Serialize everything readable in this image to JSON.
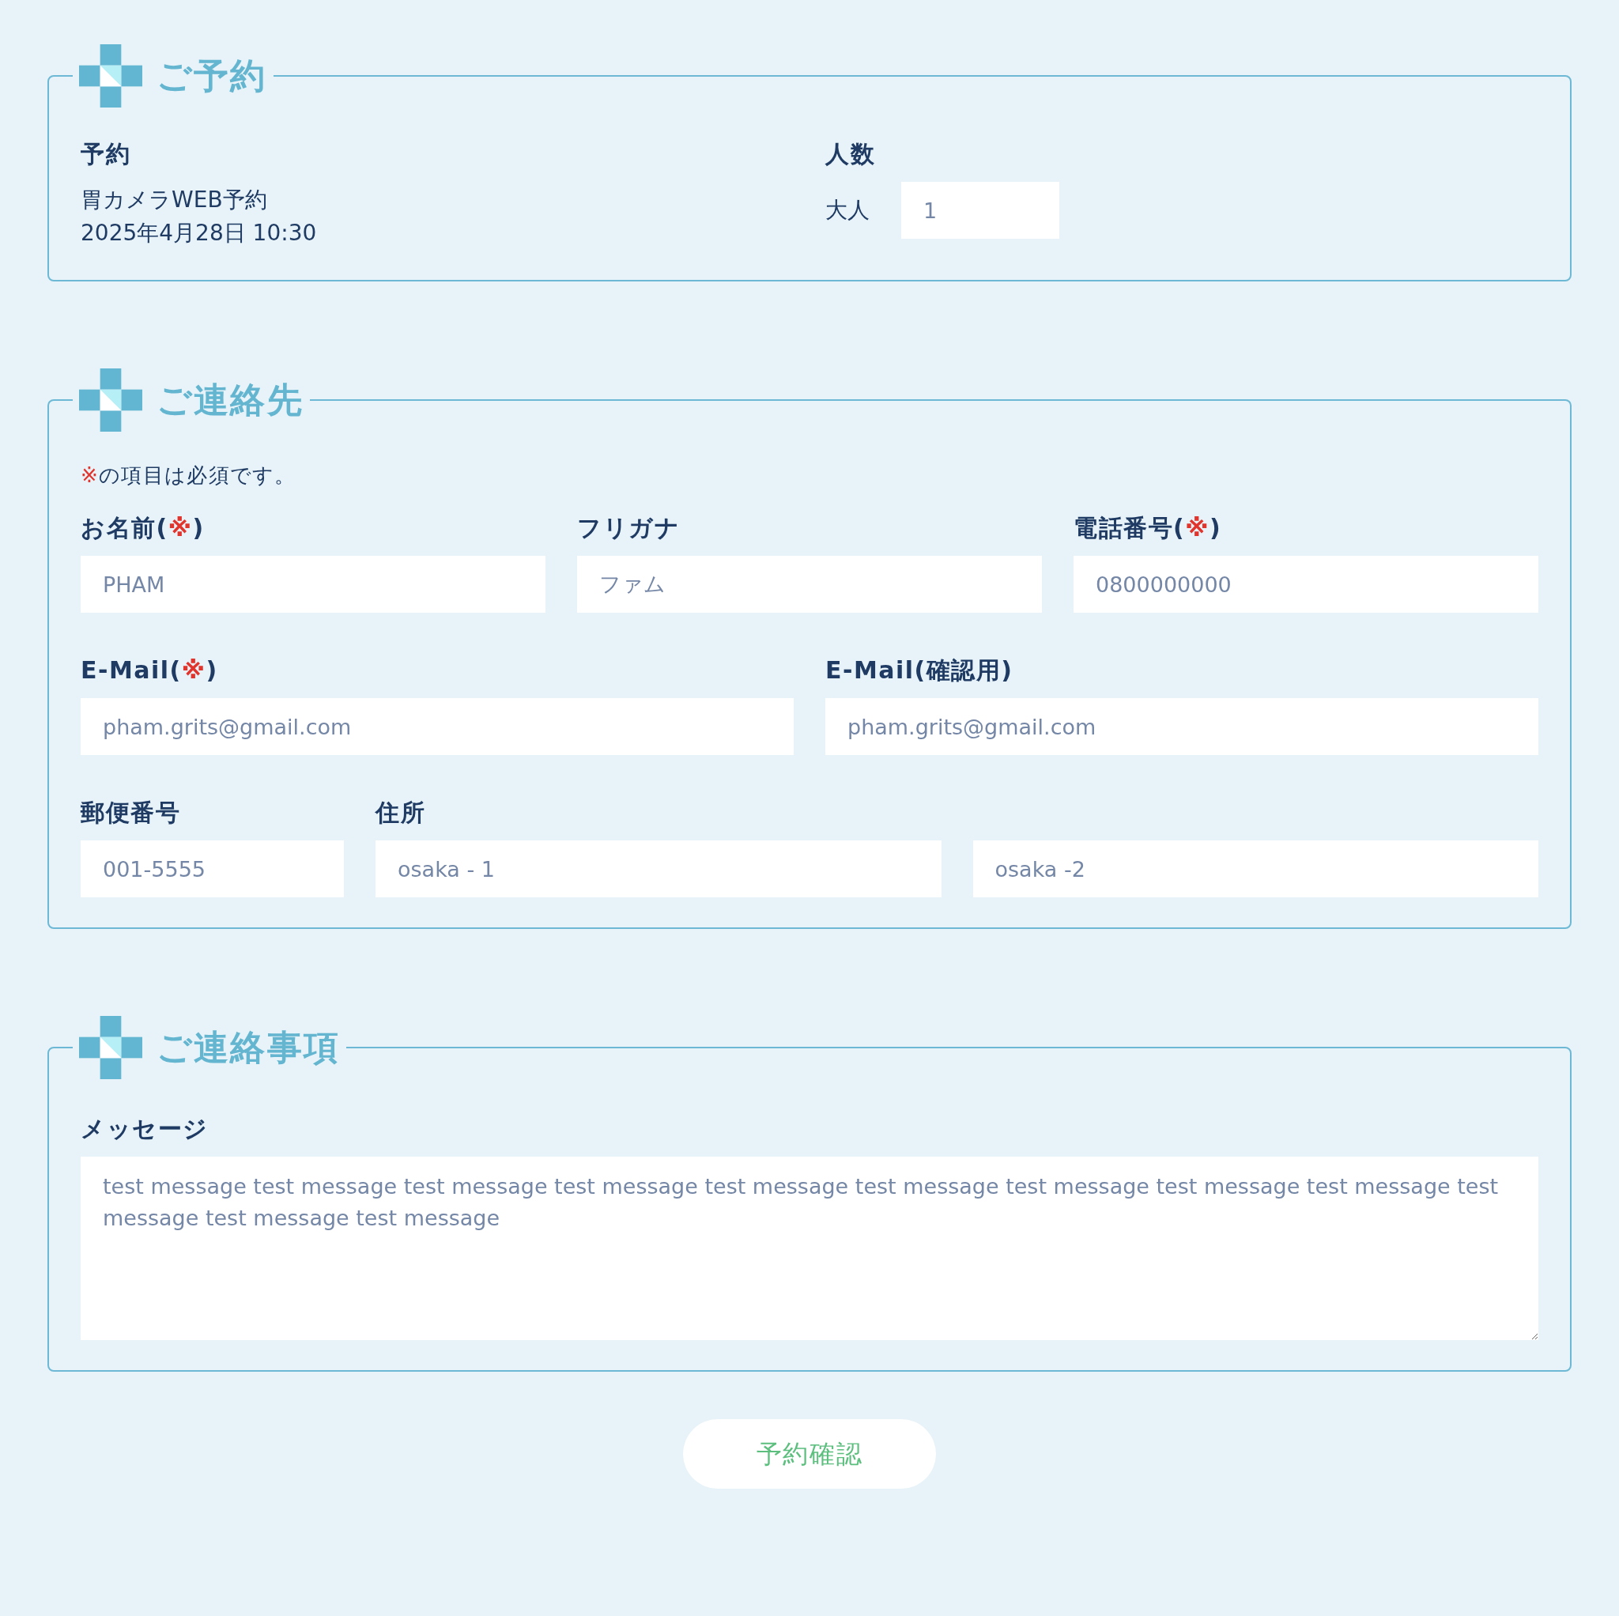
{
  "sections": [
    {
      "kind": "reservation",
      "title": "ご予約",
      "reservation": {
        "label": "予約",
        "lines": [
          "胃カメラWEB予約",
          "2025年4月28日 10:30"
        ]
      },
      "party": {
        "label": "人数",
        "adult_label": "大人",
        "adult_value": "1"
      }
    },
    {
      "kind": "contact",
      "title": "ご連絡先",
      "note": {
        "mark": "※",
        "text": "の項目は必須です。"
      },
      "rows": [
        [
          {
            "label": "お名前(",
            "required_mark": "※",
            "label_tail": ")",
            "value": "PHAM"
          },
          {
            "label": "フリガナ",
            "value": "ファム"
          },
          {
            "label": "電話番号(",
            "required_mark": "※",
            "label_tail": ")",
            "value": "0800000000"
          }
        ],
        [
          {
            "label": "E-Mail(",
            "required_mark": "※",
            "label_tail": ")",
            "value": "pham.grits@gmail.com"
          },
          {
            "label": "E-Mail(確認用)",
            "value": "pham.grits@gmail.com"
          }
        ],
        [
          {
            "label": "郵便番号",
            "value": "001-5555"
          },
          {
            "label": "住所",
            "value": "osaka - 1"
          },
          {
            "value": "osaka -2"
          }
        ]
      ]
    },
    {
      "kind": "message",
      "title": "ご連絡事項",
      "label": "メッセージ",
      "value": "test message test message test message test message test message test message test message test message test message test message test message test message"
    }
  ],
  "submit_button": "予約確認"
}
